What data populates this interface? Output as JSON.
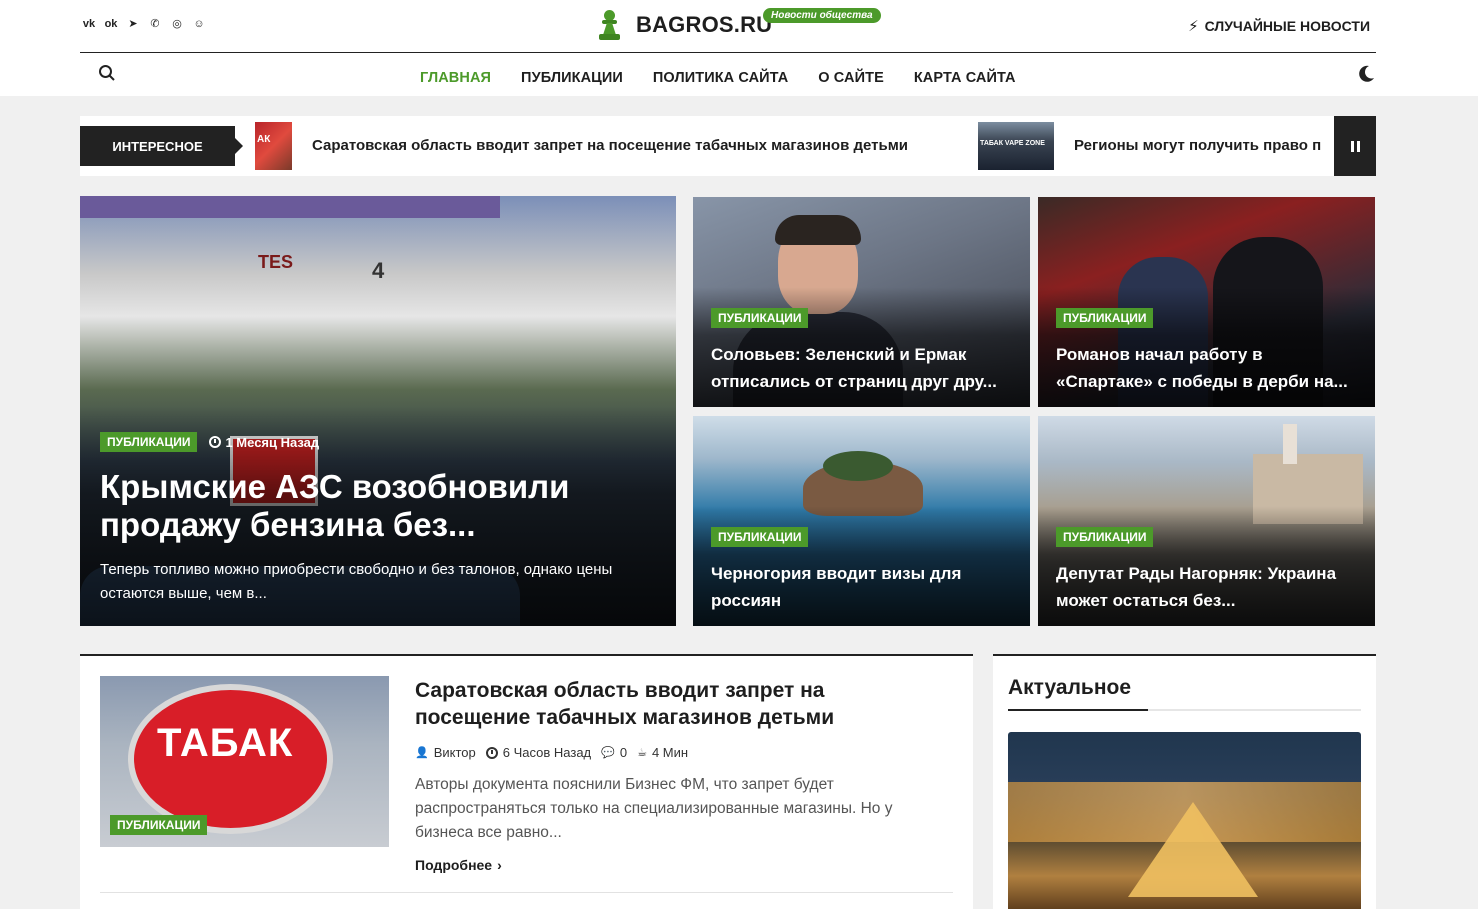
{
  "header": {
    "social_icons": [
      "vk-icon",
      "ok-icon",
      "telegram-icon",
      "viber-icon",
      "whatsapp-icon",
      "yandex-zen-icon"
    ],
    "social_glyphs": [
      "vk",
      "ok",
      "➤",
      "✆",
      "◎",
      "☺"
    ],
    "logo_text": "BAGROS.RU",
    "logo_tag": "Новости общества",
    "random_label": "СЛУЧАЙНЫЕ НОВОСТИ",
    "colors": {
      "accent": "#4c9a2a",
      "dark": "#222222"
    }
  },
  "nav": {
    "items": [
      {
        "label": "ГЛАВНАЯ",
        "active": true
      },
      {
        "label": "ПУБЛИКАЦИИ",
        "active": false
      },
      {
        "label": "ПОЛИТИКА САЙТА",
        "active": false
      },
      {
        "label": "О САЙТЕ",
        "active": false
      },
      {
        "label": "КАРТА САЙТА",
        "active": false
      }
    ]
  },
  "ticker": {
    "label": "ИНТЕРЕСНОЕ",
    "items": [
      {
        "title": "Саратовская область вводит запрет на посещение табачных магазинов детьми",
        "thumb_text": "АК"
      },
      {
        "title": "Регионы могут получить право п",
        "thumb_text": "ТАБАК VAPE ZONE"
      }
    ]
  },
  "featured": {
    "main": {
      "category": "ПУБЛИКАЦИИ",
      "time": "1 Месяц Назад",
      "title": "Крымские АЗС возобновили продажу бензина без...",
      "excerpt": "  Теперь топливо можно приобрести свободно и без талонов, однако цены остаются выше, чем в...",
      "image_text": {
        "brand": "TES",
        "number": "4"
      }
    },
    "grid": [
      {
        "category": "ПУБЛИКАЦИИ",
        "title": "Соловьев: Зеленский и Ермак отписались от страниц друг дру..."
      },
      {
        "category": "ПУБЛИКАЦИИ",
        "title": "Романов начал работу в «Спартаке» с победы в дерби на..."
      },
      {
        "category": "ПУБЛИКАЦИИ",
        "title": "Черногория вводит визы для россиян"
      },
      {
        "category": "ПУБЛИКАЦИИ",
        "title": "Депутат Рады Нагорняк: Украина может остаться без..."
      }
    ]
  },
  "post": {
    "category": "ПУБЛИКАЦИИ",
    "image_text": "ТАБАК",
    "title": "Саратовская область вводит запрет на посещение табачных магазинов детьми",
    "author": "Виктор",
    "time": "6 Часов Назад",
    "comments": "0",
    "read_time": "4 Мин",
    "excerpt": "Авторы документа пояснили Бизнес ФМ, что запрет будет распространяться только на специализированные магазины. Но у бизнеса все равно...",
    "more": "Подробнее"
  },
  "sidebar": {
    "title": "Актуальное"
  }
}
